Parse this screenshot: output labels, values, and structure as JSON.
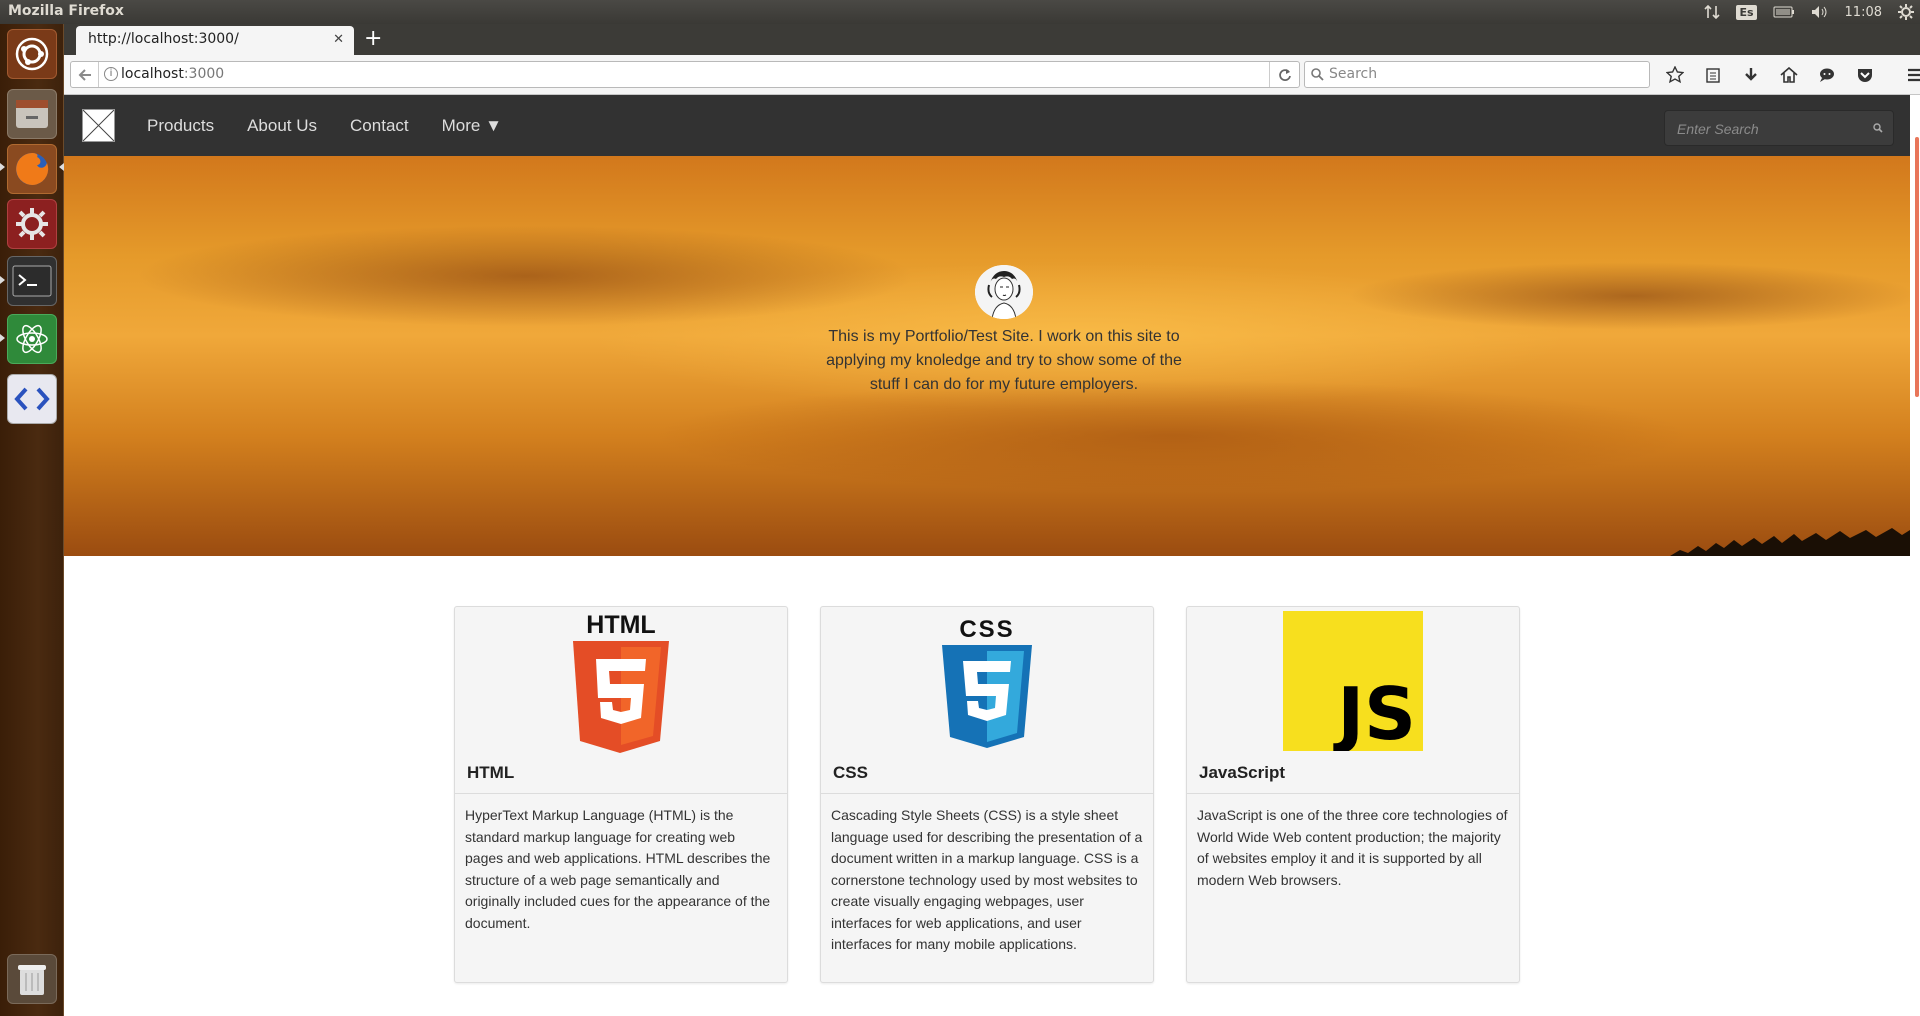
{
  "os": {
    "window_title": "Mozilla Firefox",
    "keyboard_layout": "Es",
    "clock": "11:08"
  },
  "browser": {
    "tab_title": "http://localhost:3000/",
    "url_host": "localhost",
    "url_port": ":3000",
    "search_placeholder": "Search"
  },
  "site": {
    "nav": {
      "links": [
        "Products",
        "About Us",
        "Contact"
      ],
      "more_label": "More ▼",
      "search_placeholder": "Enter Search"
    },
    "hero": {
      "text": "This is my Portfolio/Test Site. I work on this site to applying my knoledge and try to show some of the stuff I can do for my future employers."
    },
    "cards": [
      {
        "title": "HTML",
        "logo_text": "HTML",
        "body": "HyperText Markup Language (HTML) is the standard markup language for creating web pages and web applications. HTML describes the structure of a web page semantically and originally included cues for the appearance of the document."
      },
      {
        "title": "CSS",
        "logo_text": "CSS",
        "body": "Cascading Style Sheets (CSS) is a style sheet language used for describing the presentation of a document written in a markup language. CSS is a cornerstone technology used by most websites to create visually engaging webpages, user interfaces for web applications, and user interfaces for many mobile applications."
      },
      {
        "title": "JavaScript",
        "logo_text": "JS",
        "body": "JavaScript is one of the three core technologies of World Wide Web content production; the majority of websites employ it and it is supported by all modern Web browsers."
      }
    ]
  }
}
